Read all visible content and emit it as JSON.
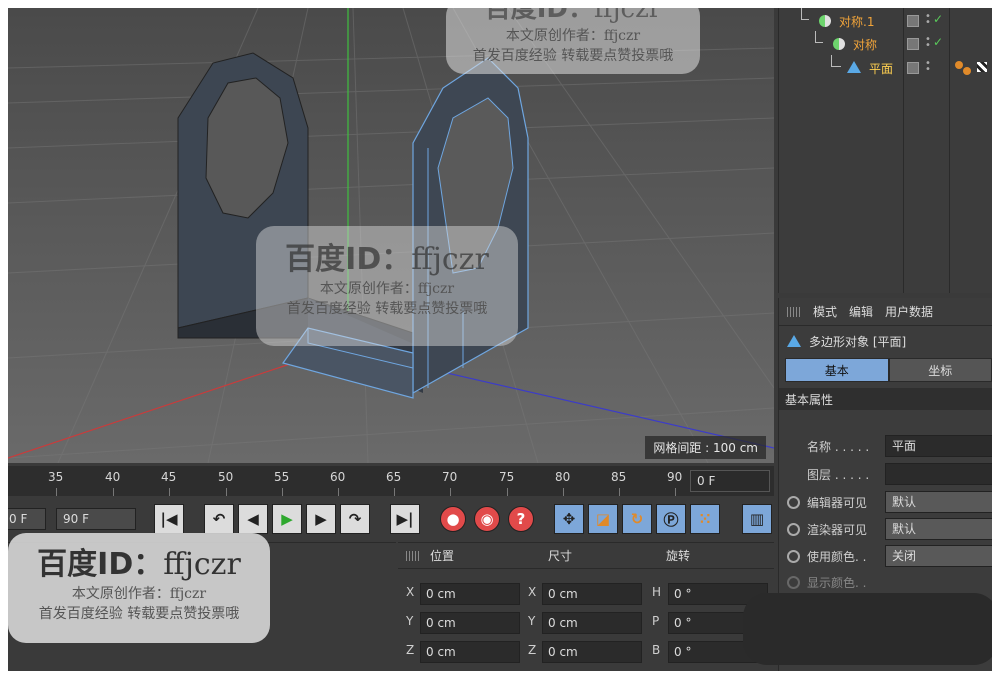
{
  "viewport": {
    "grid_readout": "网格间距 : 100 cm"
  },
  "object_manager": {
    "objects": [
      {
        "name": "对称.1"
      },
      {
        "name": "对称"
      },
      {
        "name": "平面"
      }
    ]
  },
  "attributes": {
    "menu": [
      "模式",
      "编辑",
      "用户数据"
    ],
    "title": "多边形对象 [平面]",
    "tabs": [
      "基本",
      "坐标"
    ],
    "section": "基本属性",
    "fields": {
      "name_label": "名称 . . . . .",
      "name_value": "平面",
      "layer_label": "图层 . . . . .",
      "editor_visible_label": "编辑器可见",
      "editor_visible_value": "默认",
      "render_visible_label": "渲染器可见",
      "render_visible_value": "默认",
      "use_color_label": "使用颜色. .",
      "use_color_value": "关闭",
      "display_color_label": "显示颜色. ."
    }
  },
  "timeline": {
    "ticks": [
      "35",
      "40",
      "45",
      "50",
      "55",
      "60",
      "65",
      "70",
      "75",
      "80",
      "85",
      "90"
    ],
    "current_frame": "0 F"
  },
  "transport": {
    "start_frame": "0 F",
    "end_frame": "90 F"
  },
  "coordinates": {
    "headers": [
      "位置",
      "尺寸",
      "旋转"
    ],
    "rows": [
      {
        "axis1": "X",
        "pos": "0 cm",
        "axis2": "X",
        "size": "0 cm",
        "axis3": "H",
        "rot": "0 °"
      },
      {
        "axis1": "Y",
        "pos": "0 cm",
        "axis2": "Y",
        "size": "0 cm",
        "axis3": "P",
        "rot": "0 °"
      },
      {
        "axis1": "Z",
        "pos": "0 cm",
        "axis2": "Z",
        "size": "0 cm",
        "axis3": "B",
        "rot": "0 °"
      }
    ]
  },
  "watermarks": {
    "id_text": "百度ID：",
    "id_value": "ffjczr",
    "line1": "本文原创作者：ffjczr",
    "line2": "首发百度经验 转载要点赞投票哦"
  }
}
